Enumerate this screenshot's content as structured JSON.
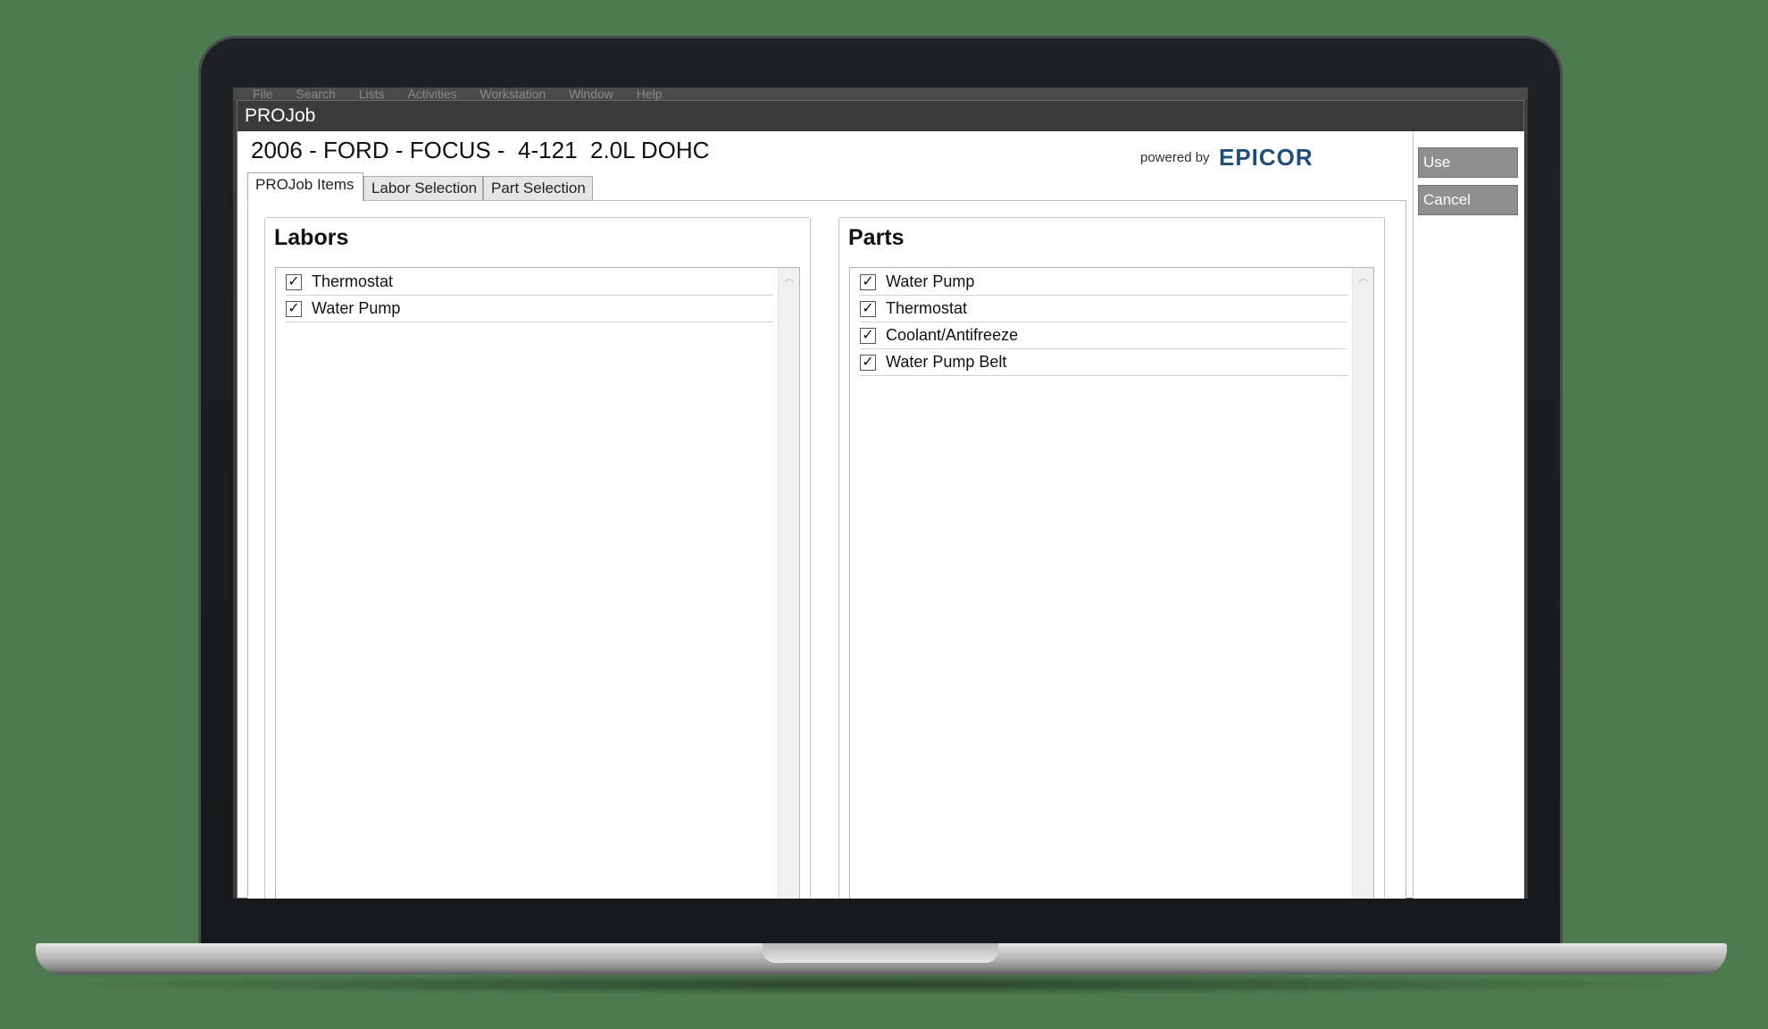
{
  "window": {
    "title": "PROJob"
  },
  "background_menu": [
    "File",
    "Search",
    "Lists",
    "Activities",
    "Workstation",
    "Window",
    "Help"
  ],
  "vehicle": {
    "title": "2006 - FORD - FOCUS -  4-121  2.0L DOHC"
  },
  "branding": {
    "powered_by": "powered by",
    "brand": "EPICOR",
    "brand_color": "#1f4e79"
  },
  "tabs": [
    {
      "label": "PROJob Items",
      "active": true
    },
    {
      "label": "Labor Selection",
      "active": false
    },
    {
      "label": "Part Selection",
      "active": false
    }
  ],
  "labors": {
    "title": "Labors",
    "items": [
      {
        "label": "Thermostat",
        "checked": true
      },
      {
        "label": "Water Pump",
        "checked": true
      }
    ]
  },
  "parts": {
    "title": "Parts",
    "items": [
      {
        "label": "Water Pump",
        "checked": true
      },
      {
        "label": "Thermostat",
        "checked": true
      },
      {
        "label": "Coolant/Antifreeze",
        "checked": true
      },
      {
        "label": "Water Pump Belt",
        "checked": true
      }
    ]
  },
  "actions": {
    "use_label": "Use",
    "cancel_label": "Cancel"
  },
  "check_glyph": "✓"
}
